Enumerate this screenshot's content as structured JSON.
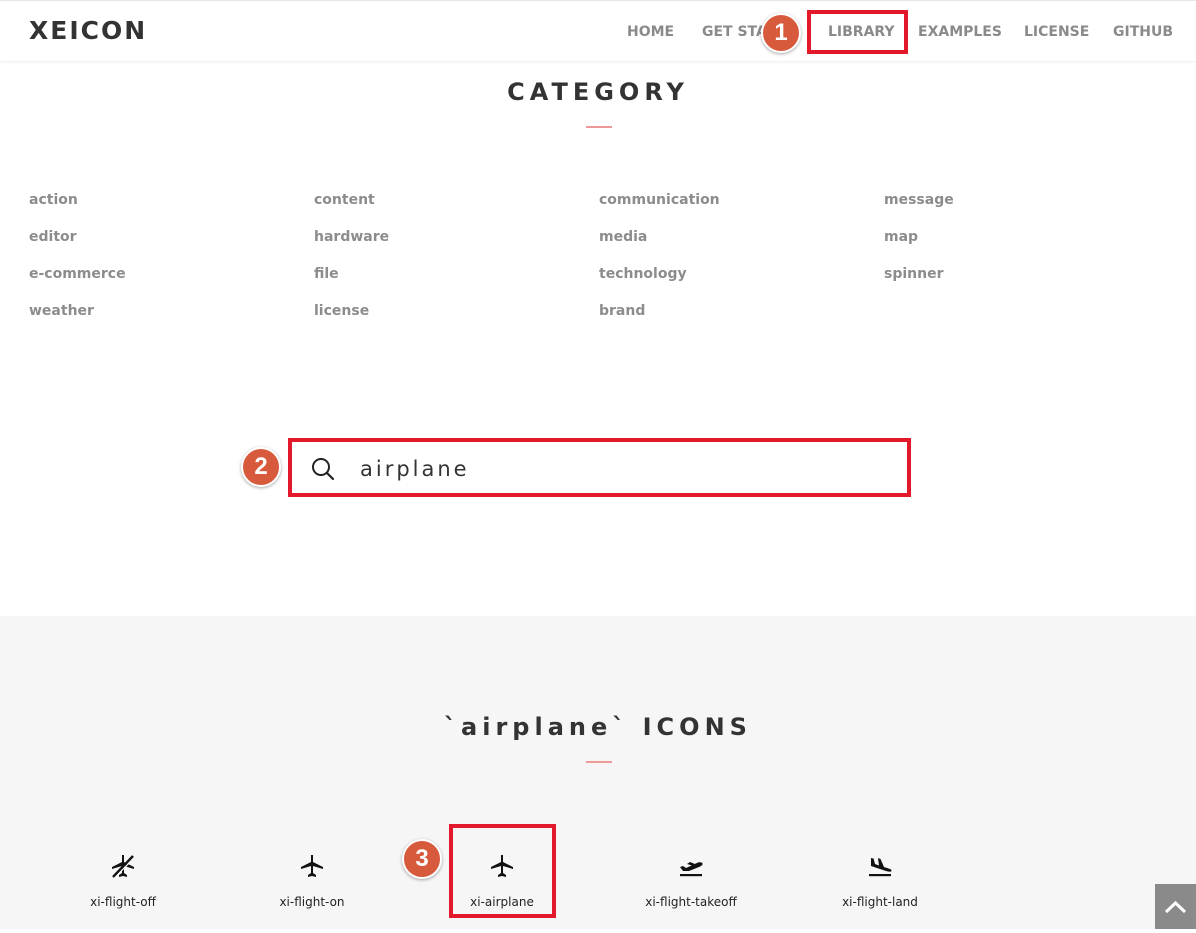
{
  "header": {
    "logo": "XEICON",
    "nav": [
      "HOME",
      "GET STA",
      "LIBRARY",
      "EXAMPLES",
      "LICENSE",
      "GITHUB"
    ]
  },
  "category": {
    "title": "CATEGORY",
    "items": [
      [
        "action",
        "content",
        "communication",
        "message"
      ],
      [
        "editor",
        "hardware",
        "media",
        "map"
      ],
      [
        "e-commerce",
        "file",
        "technology",
        "spinner"
      ],
      [
        "weather",
        "license",
        "brand"
      ]
    ]
  },
  "search": {
    "value": "airplane"
  },
  "results": {
    "title": "`airplane` ICONS",
    "icons": [
      {
        "label": "xi-flight-off",
        "icon": "flight-off-icon"
      },
      {
        "label": "xi-flight-on",
        "icon": "flight-on-icon"
      },
      {
        "label": "xi-airplane",
        "icon": "airplane-icon"
      },
      {
        "label": "xi-flight-takeoff",
        "icon": "flight-takeoff-icon"
      },
      {
        "label": "xi-flight-land",
        "icon": "flight-land-icon"
      }
    ]
  },
  "annotations": [
    "1",
    "2",
    "3"
  ],
  "colors": {
    "annotation_box": "#e3182b",
    "annotation_badge": "#d85a3c",
    "title_rule": "#ef9a9a",
    "results_background": "#f6f6f6"
  }
}
